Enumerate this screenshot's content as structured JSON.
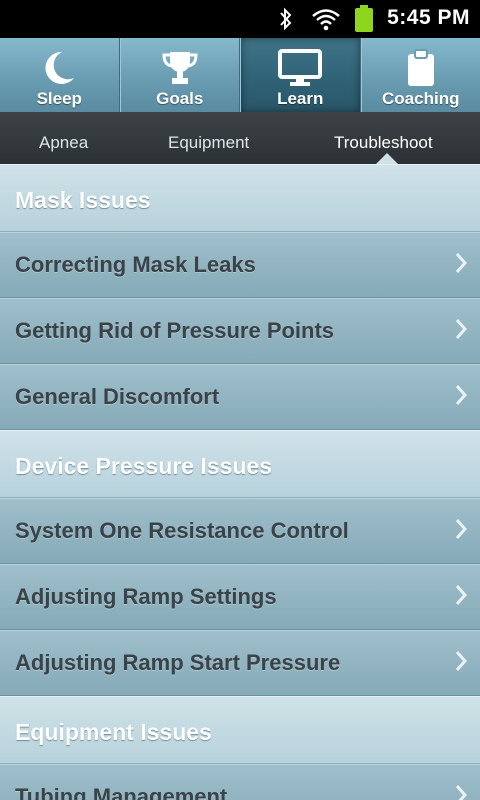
{
  "status_bar": {
    "time": "5:45 PM",
    "icons": [
      "bluetooth-icon",
      "wifi-icon",
      "battery-icon"
    ],
    "battery_color": "#8ed61e"
  },
  "tabs": [
    {
      "label": "Sleep",
      "icon": "moon-icon",
      "active": false
    },
    {
      "label": "Goals",
      "icon": "trophy-icon",
      "active": false
    },
    {
      "label": "Learn",
      "icon": "monitor-icon",
      "active": true
    },
    {
      "label": "Coaching",
      "icon": "clipboard-icon",
      "active": false
    }
  ],
  "subtabs": [
    {
      "label": "Apnea",
      "active": false
    },
    {
      "label": "Equipment",
      "active": false
    },
    {
      "label": "Troubleshoot",
      "active": true
    }
  ],
  "sections": [
    {
      "title": "Mask Issues",
      "items": [
        "Correcting Mask Leaks",
        "Getting Rid of Pressure Points",
        "General Discomfort"
      ]
    },
    {
      "title": "Device Pressure Issues",
      "items": [
        "System One Resistance Control",
        "Adjusting Ramp Settings",
        "Adjusting Ramp Start Pressure"
      ]
    },
    {
      "title": "Equipment Issues",
      "items": [
        "Tubing Management"
      ]
    }
  ],
  "colors": {
    "accent_active_tab": "#2f6175",
    "tab_bar": "#6a9db2",
    "sub_bar": "#2c3135",
    "row": "#8fb0bd"
  }
}
